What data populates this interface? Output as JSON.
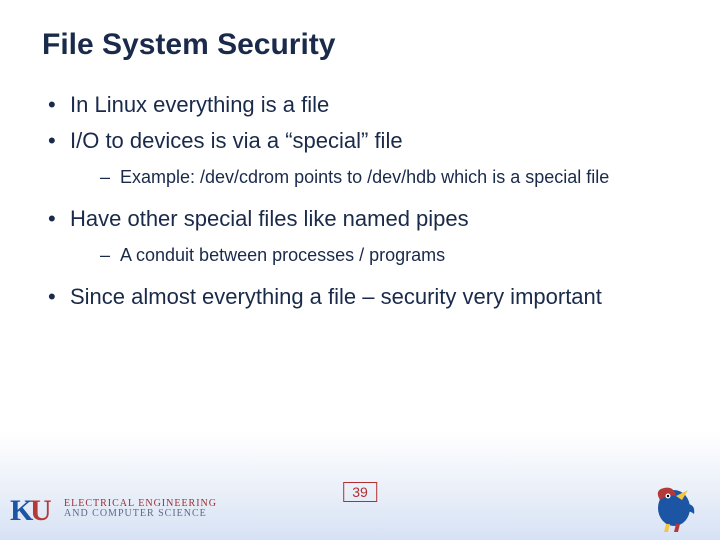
{
  "title": "File System Security",
  "bullets": [
    {
      "text": "In Linux everything is a file",
      "sub": []
    },
    {
      "text": "I/O to devices is via a “special” file",
      "sub": [
        "Example: /dev/cdrom points to /dev/hdb which is a special file"
      ]
    },
    {
      "text": "Have other special files like named pipes",
      "sub": [
        "A conduit between processes / programs"
      ]
    },
    {
      "text": "Since almost everything a file – security very important",
      "sub": []
    }
  ],
  "slide_number": "39",
  "logo": {
    "line1": "ELECTRICAL ENGINEERING",
    "line2": "AND COMPUTER SCIENCE"
  }
}
